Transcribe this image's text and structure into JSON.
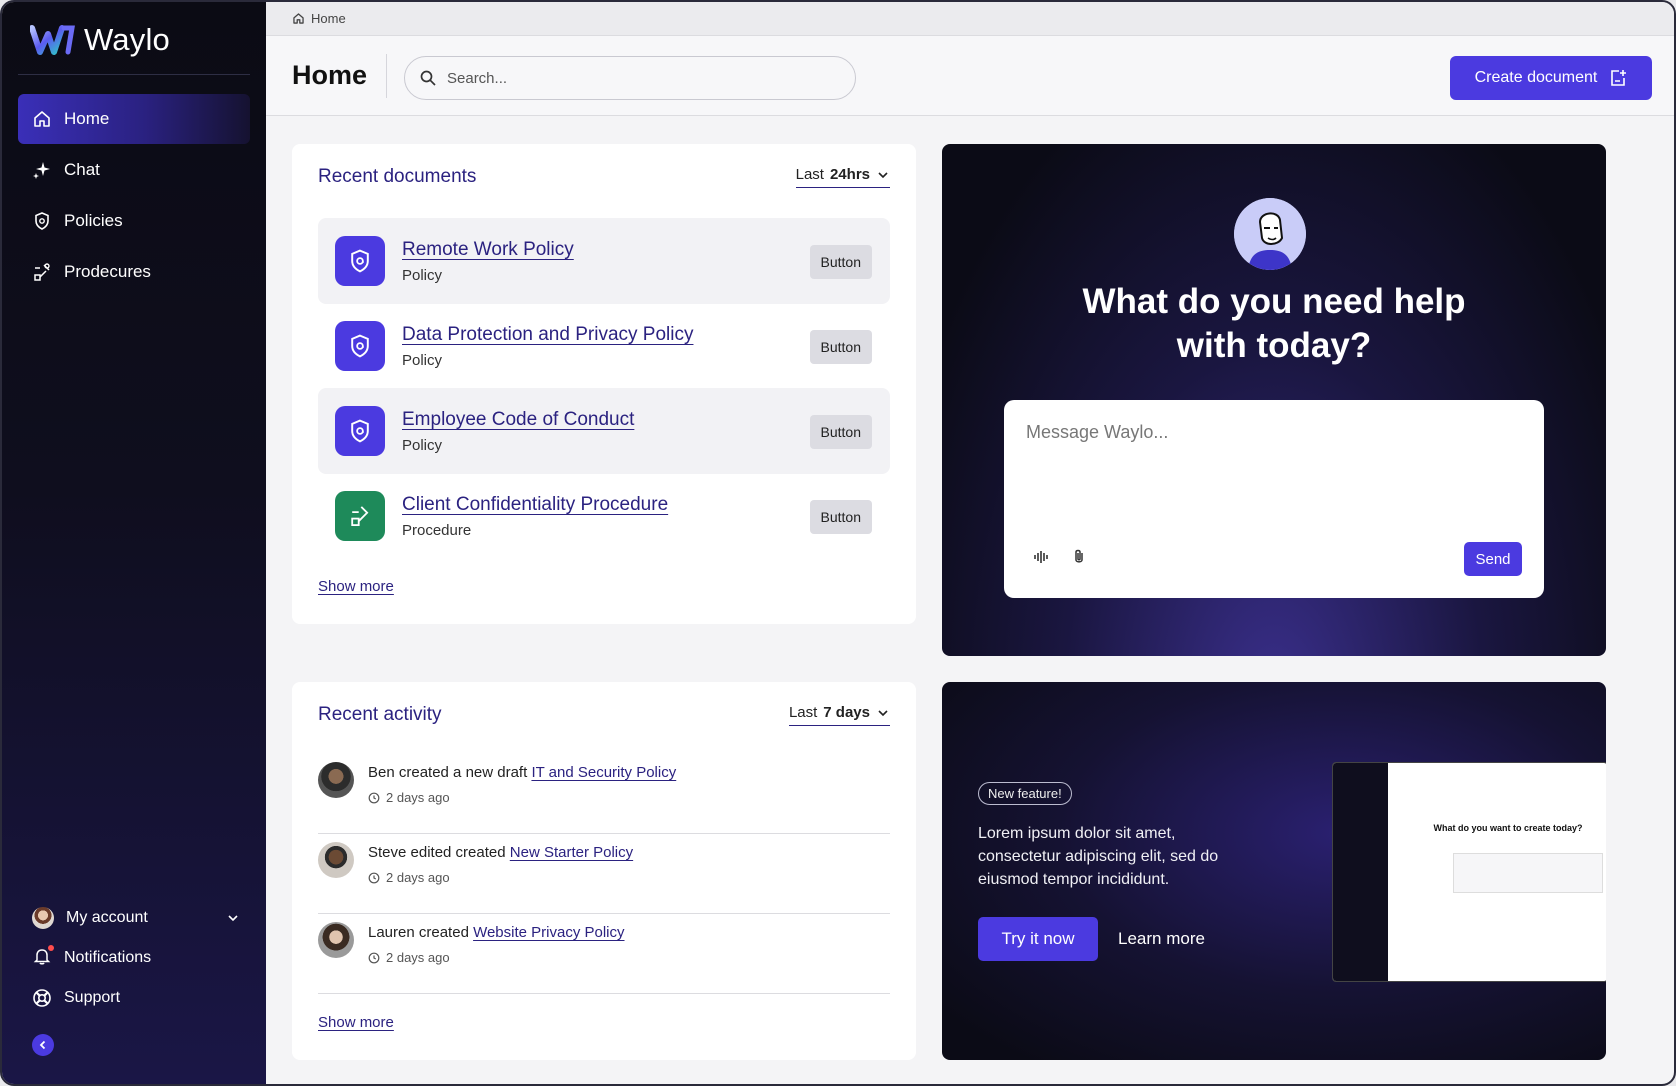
{
  "app": {
    "name": "Waylo"
  },
  "sidebar": {
    "items": [
      {
        "label": "Home",
        "icon": "home-icon",
        "active": true
      },
      {
        "label": "Chat",
        "icon": "sparkle-icon",
        "active": false
      },
      {
        "label": "Policies",
        "icon": "shield-icon",
        "active": false
      },
      {
        "label": "Prodecures",
        "icon": "procedure-icon",
        "active": false
      }
    ],
    "bottom": {
      "account": "My account",
      "notifications": "Notifications",
      "support": "Support"
    }
  },
  "breadcrumb": {
    "label": "Home"
  },
  "header": {
    "title": "Home",
    "search_placeholder": "Search...",
    "create_label": "Create document"
  },
  "recent_documents": {
    "title": "Recent documents",
    "filter_prefix": "Last",
    "filter_value": "24hrs",
    "items": [
      {
        "title": "Remote Work Policy",
        "type": "Policy",
        "button": "Button",
        "kind": "policy"
      },
      {
        "title": "Data Protection and Privacy Policy",
        "type": "Policy",
        "button": "Button",
        "kind": "policy"
      },
      {
        "title": "Employee Code of Conduct",
        "type": "Policy",
        "button": "Button",
        "kind": "policy"
      },
      {
        "title": "Client Confidentiality Procedure",
        "type": "Procedure",
        "button": "Button",
        "kind": "procedure"
      }
    ],
    "show_more": "Show more"
  },
  "recent_activity": {
    "title": "Recent activity",
    "filter_prefix": "Last",
    "filter_value": "7 days",
    "items": [
      {
        "text": "Ben created a new draft",
        "link": "IT and Security Policy",
        "time": "2 days ago"
      },
      {
        "text": "Steve edited created",
        "link": "New Starter Policy",
        "time": "2 days ago"
      },
      {
        "text": "Lauren created",
        "link": "Website Privacy Policy",
        "time": "2 days ago"
      }
    ],
    "show_more": "Show more"
  },
  "help": {
    "title_line1": "What do you need help",
    "title_line2": "with today?",
    "message_placeholder": "Message Waylo...",
    "send_label": "Send"
  },
  "feature": {
    "badge": "New feature!",
    "text": "Lorem ipsum dolor sit amet, consectetur adipiscing elit, sed do eiusmod tempor incididunt.",
    "try_label": "Try it now",
    "learn_label": "Learn more",
    "preview_title": "What do you want to create today?"
  },
  "colors": {
    "accent": "#4b3ae0",
    "link": "#2b2280",
    "procedure": "#1e8a5a"
  }
}
